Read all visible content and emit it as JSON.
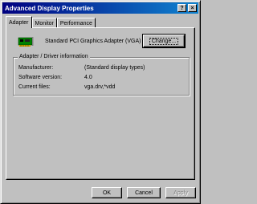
{
  "window": {
    "title": "Advanced Display Properties",
    "help_label": "?",
    "close_label": "×"
  },
  "tabs": [
    {
      "label": "Adapter"
    },
    {
      "label": "Monitor"
    },
    {
      "label": "Performance"
    }
  ],
  "adapter": {
    "name": "Standard PCI Graphics Adapter (VGA)",
    "icon": "display-adapter-card-icon",
    "change_label": "Change..."
  },
  "driver_info": {
    "group_label": "Adapter / Driver information",
    "manufacturer_label": "Manufacturer:",
    "manufacturer_value": "(Standard display types)",
    "version_label": "Software version:",
    "version_value": "4.0",
    "files_label": "Current files:",
    "files_value": "vga.drv,*vdd"
  },
  "buttons": {
    "ok": "OK",
    "cancel": "Cancel",
    "apply": "Apply"
  },
  "colors": {
    "titlebar_start": "#000080",
    "titlebar_end": "#1084d0",
    "face": "#c0c0c0"
  }
}
